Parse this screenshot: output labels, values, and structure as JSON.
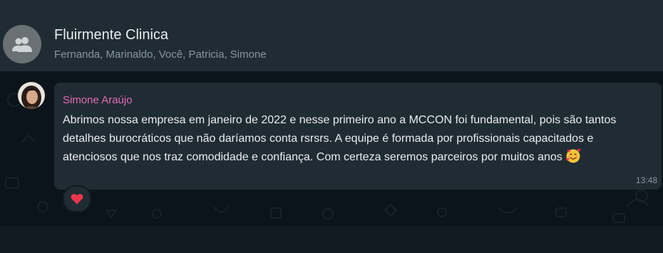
{
  "header": {
    "group_name": "Fluirmente Clinica",
    "members": "Fernanda, Marinaldo, Você, Patricia, Simone",
    "avatar_icon": "group-icon"
  },
  "message": {
    "sender": "Simone Araújo",
    "sender_color": "#e26ab6",
    "text": "Abrimos nossa empresa em janeiro de 2022 e nesse primeiro ano a MCCON foi fundamental, pois são tantos detalhes burocráticos que não daríamos conta rsrsrs. A equipe é formada por profissionais capacitados e atenciosos que nos traz comodidade e confiança. Com certeza seremos parceiros por muitos anos",
    "emoji": "smiling-face-with-hearts-icon",
    "time": "13:48",
    "reaction": "heart-icon"
  },
  "colors": {
    "header_bg": "#202c33",
    "chat_bg": "#0b141a",
    "bubble_bg": "#202c33",
    "text": "#e9edef",
    "muted": "#8696a0"
  }
}
